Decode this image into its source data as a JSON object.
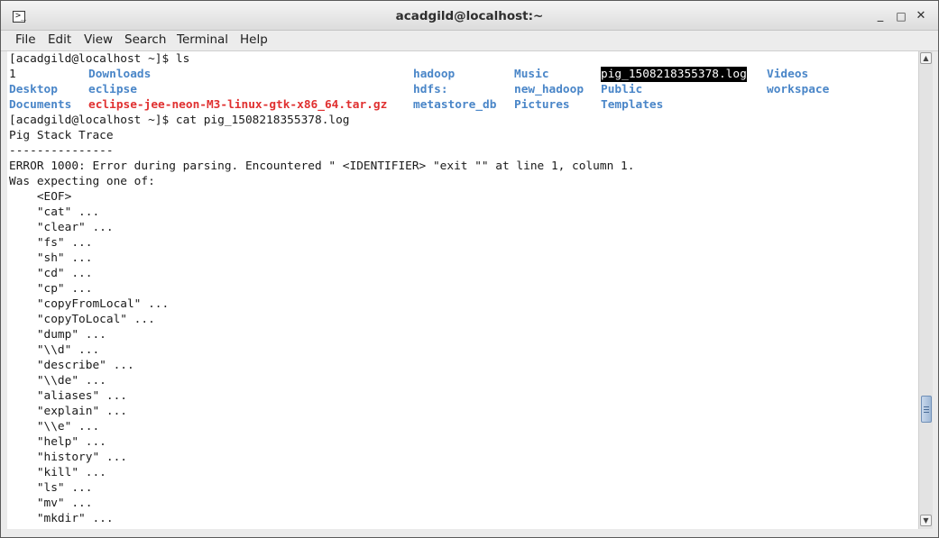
{
  "window": {
    "title": "acadgild@localhost:~",
    "icon": "terminal-icon",
    "minimize_glyph": "_",
    "maximize_glyph": "□",
    "close_glyph": "✕"
  },
  "menu": [
    "File",
    "Edit",
    "View",
    "Search",
    "Terminal",
    "Help"
  ],
  "colors": {
    "directory": "#4a86c8",
    "archive": "#e03030",
    "highlight_bg": "#000000"
  },
  "terminal": {
    "prompt_ls": "[acadgild@localhost ~]$ ls",
    "ls_rows": [
      [
        {
          "text": "1",
          "kind": "plain"
        },
        {
          "text": "Downloads",
          "kind": "dir"
        },
        {
          "text": "hadoop",
          "kind": "dir"
        },
        {
          "text": "Music",
          "kind": "dir"
        },
        {
          "text": "pig_1508218355378.log",
          "kind": "highlight"
        },
        {
          "text": "Videos",
          "kind": "dir"
        }
      ],
      [
        {
          "text": "Desktop",
          "kind": "dir"
        },
        {
          "text": "eclipse",
          "kind": "dir"
        },
        {
          "text": "hdfs:",
          "kind": "dir"
        },
        {
          "text": "new_hadoop",
          "kind": "dir"
        },
        {
          "text": "Public",
          "kind": "dir"
        },
        {
          "text": "workspace",
          "kind": "dir"
        }
      ],
      [
        {
          "text": "Documents",
          "kind": "dir"
        },
        {
          "text": "eclipse-jee-neon-M3-linux-gtk-x86_64.tar.gz",
          "kind": "archive"
        },
        {
          "text": "metastore_db",
          "kind": "dir"
        },
        {
          "text": "Pictures",
          "kind": "dir"
        },
        {
          "text": "Templates",
          "kind": "dir"
        },
        {
          "text": "",
          "kind": "plain"
        }
      ]
    ],
    "lines_after": [
      "[acadgild@localhost ~]$ cat pig_1508218355378.log",
      "Pig Stack Trace",
      "---------------",
      "ERROR 1000: Error during parsing. Encountered \" <IDENTIFIER> \"exit \"\" at line 1, column 1.",
      "Was expecting one of:",
      "    <EOF>",
      "    \"cat\" ...",
      "    \"clear\" ...",
      "    \"fs\" ...",
      "    \"sh\" ...",
      "    \"cd\" ...",
      "    \"cp\" ...",
      "    \"copyFromLocal\" ...",
      "    \"copyToLocal\" ...",
      "    \"dump\" ...",
      "    \"\\\\d\" ...",
      "    \"describe\" ...",
      "    \"\\\\de\" ...",
      "    \"aliases\" ...",
      "    \"explain\" ...",
      "    \"\\\\e\" ...",
      "    \"help\" ...",
      "    \"history\" ...",
      "    \"kill\" ...",
      "    \"ls\" ...",
      "    \"mv\" ...",
      "    \"mkdir\" ..."
    ]
  },
  "scrollbar": {
    "up_arrow": "▲",
    "down_arrow": "▼",
    "position_fraction": 0.78
  }
}
